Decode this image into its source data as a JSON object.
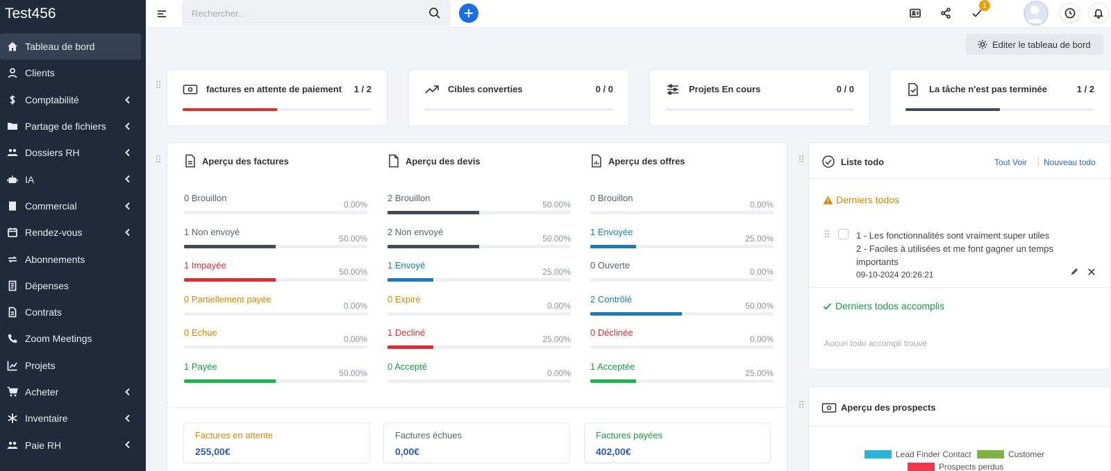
{
  "sidebar": {
    "brand": "Test456",
    "items": [
      {
        "label": "Tableau de bord",
        "icon": "home-icon",
        "active": true,
        "caret": false
      },
      {
        "label": "Clients",
        "icon": "user-icon",
        "caret": false
      },
      {
        "label": "Comptabilité",
        "icon": "dollar-icon",
        "caret": true
      },
      {
        "label": "Partage de fichiers",
        "icon": "folder-icon",
        "caret": true
      },
      {
        "label": "Dossiers RH",
        "icon": "users-icon",
        "caret": true
      },
      {
        "label": "IA",
        "icon": "robot-icon",
        "caret": true
      },
      {
        "label": "Commercial",
        "icon": "building-icon",
        "caret": true
      },
      {
        "label": "Rendez-vous",
        "icon": "calendar-icon",
        "caret": true
      },
      {
        "label": "Abonnements",
        "icon": "repeat-icon",
        "caret": false
      },
      {
        "label": "Dépenses",
        "icon": "receipt-icon",
        "caret": false
      },
      {
        "label": "Contrats",
        "icon": "file-icon",
        "caret": false
      },
      {
        "label": "Zoom Meetings",
        "icon": "phone-icon",
        "caret": false
      },
      {
        "label": "Projets",
        "icon": "chart-icon",
        "caret": false
      },
      {
        "label": "Acheter",
        "icon": "cart-icon",
        "caret": true
      },
      {
        "label": "Inventaire",
        "icon": "snowflake-icon",
        "caret": true
      },
      {
        "label": "Paie RH",
        "icon": "users-icon",
        "caret": true
      }
    ]
  },
  "topbar": {
    "search_placeholder": "Rechercher...",
    "notification_count": "1"
  },
  "edit_dashboard_label": "Editer le tableau de bord",
  "stat_cards": [
    {
      "label": "factures en attente de paiement",
      "value": "1 / 2",
      "progress": 0.5,
      "color": "#d63031",
      "icon": "money-icon"
    },
    {
      "label": "Cibles converties",
      "value": "0 / 0",
      "progress": 0,
      "color": "#444b57",
      "icon": "trend-icon"
    },
    {
      "label": "Projets En cours",
      "value": "0 / 0",
      "progress": 0,
      "color": "#444b57",
      "icon": "sliders-icon"
    },
    {
      "label": "La tâche n'est pas terminée",
      "value": "1 / 2",
      "progress": 0.5,
      "color": "#444b57",
      "icon": "file-check-icon"
    }
  ],
  "overview": {
    "invoices": {
      "title": "Aperçu des factures",
      "rows": [
        {
          "count": "0",
          "label": "Brouillon",
          "pct": "0.00%",
          "progress": 0,
          "color": "#5a6170"
        },
        {
          "count": "1",
          "label": "Non envoyé",
          "pct": "50.00%",
          "progress": 0.5,
          "color": "#5a6170",
          "bar": "#444b57"
        },
        {
          "count": "1",
          "label": "Impayée",
          "pct": "50.00%",
          "progress": 0.5,
          "color": "#d63031",
          "bar": "#d63031"
        },
        {
          "count": "0",
          "label": "Partiellement payée",
          "pct": "0.00%",
          "progress": 0,
          "color": "#d18a00"
        },
        {
          "count": "0",
          "label": "Echue",
          "pct": "0.00%",
          "progress": 0,
          "color": "#d18a00"
        },
        {
          "count": "1",
          "label": "Payée",
          "pct": "50.00%",
          "progress": 0.5,
          "color": "#1a9a45",
          "bar": "#22b24c"
        }
      ]
    },
    "estimates": {
      "title": "Aperçu des devis",
      "rows": [
        {
          "count": "2",
          "label": "Brouillon",
          "pct": "50.00%",
          "progress": 0.5,
          "color": "#5a6170",
          "bar": "#444b57"
        },
        {
          "count": "2",
          "label": "Non envoyé",
          "pct": "50.00%",
          "progress": 0.5,
          "color": "#5a6170",
          "bar": "#444b57"
        },
        {
          "count": "1",
          "label": "Envoyé",
          "pct": "25.00%",
          "progress": 0.25,
          "color": "#1a7bb8",
          "bar": "#1a7bb8"
        },
        {
          "count": "0",
          "label": "Expiré",
          "pct": "0.00%",
          "progress": 0,
          "color": "#d18a00"
        },
        {
          "count": "1",
          "label": "Decliné",
          "pct": "25.00%",
          "progress": 0.25,
          "color": "#d63031",
          "bar": "#d63031"
        },
        {
          "count": "0",
          "label": "Accepté",
          "pct": "0.00%",
          "progress": 0,
          "color": "#1a9a45"
        }
      ]
    },
    "offers": {
      "title": "Aperçu des offres",
      "rows": [
        {
          "count": "0",
          "label": "Brouillon",
          "pct": "0.00%",
          "progress": 0,
          "color": "#5a6170"
        },
        {
          "count": "1",
          "label": "Envoyée",
          "pct": "25.00%",
          "progress": 0.25,
          "color": "#1a7bb8",
          "bar": "#1a7bb8"
        },
        {
          "count": "0",
          "label": "Ouverte",
          "pct": "0.00%",
          "progress": 0,
          "color": "#5a6170"
        },
        {
          "count": "2",
          "label": "Contrôlé",
          "pct": "50.00%",
          "progress": 0.5,
          "color": "#1a7bb8",
          "bar": "#1a7bb8"
        },
        {
          "count": "0",
          "label": "Déclinée",
          "pct": "0.00%",
          "progress": 0,
          "color": "#d63031"
        },
        {
          "count": "1",
          "label": "Acceptée",
          "pct": "25.00%",
          "progress": 0.25,
          "color": "#1a9a45",
          "bar": "#22b24c"
        }
      ]
    }
  },
  "summary": [
    {
      "title": "Factures en attente",
      "value": "255,00€",
      "title_color": "#d18a00"
    },
    {
      "title": "Factures échues",
      "value": "0,00€",
      "title_color": "#5a6170"
    },
    {
      "title": "Factures payées",
      "value": "402,00€",
      "title_color": "#1a9a45"
    }
  ],
  "todo": {
    "title": "Liste todo",
    "view_all": "Tout Voir",
    "new_todo": "Nouveau todo",
    "recent_title": "Derniers todos",
    "item_line1": "1 - Les fonctionnalités sont vraiment super utiles",
    "item_line2": "2 - Faciles à utilisées et me font gagner un temps",
    "item_line3": "importants",
    "item_date": "09-10-2024 20:26:21",
    "done_title": "Derniers todos accomplis",
    "empty_done": "Aucun todo accompli trouvé"
  },
  "prospects": {
    "title": "Aperçu des prospects",
    "legend": [
      {
        "label": "Lead Finder Contact",
        "color": "#29b6d6"
      },
      {
        "label": "Customer",
        "color": "#7cb342"
      },
      {
        "label": "Prospects perdus",
        "color": "#f4364c"
      }
    ]
  }
}
